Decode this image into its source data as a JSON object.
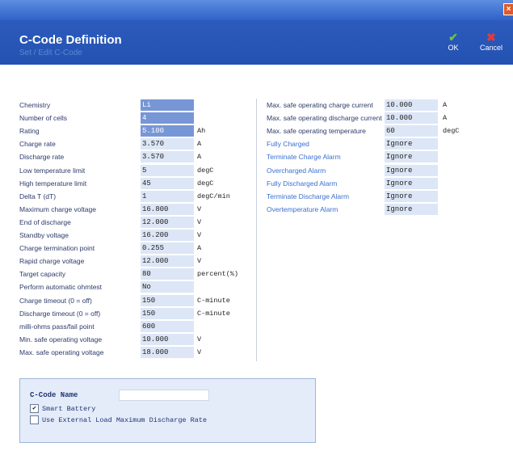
{
  "window": {
    "close_glyph": "×"
  },
  "header": {
    "title": "C-Code Definition",
    "subtitle": "Set / Edit C-Code",
    "ok_label": "OK",
    "cancel_label": "Cancel",
    "ok_icon": "✔",
    "cancel_icon": "✖"
  },
  "left_fields": [
    {
      "label": "Chemistry",
      "value": "Li",
      "unit": "",
      "selected": true
    },
    {
      "label": "Number of cells",
      "value": "4",
      "unit": "",
      "selected": true
    },
    {
      "label": "Rating",
      "value": "5.100",
      "unit": "Ah",
      "selected": true
    },
    {
      "label": "Charge rate",
      "value": "3.570",
      "unit": "A"
    },
    {
      "label": "Discharge rate",
      "value": "3.570",
      "unit": "A"
    },
    {
      "label": "Low temperature limit",
      "value": "5",
      "unit": "degC"
    },
    {
      "label": "High temperature limit",
      "value": "45",
      "unit": "degC"
    },
    {
      "label": "Delta T (dT)",
      "value": "1",
      "unit": "degC/min"
    },
    {
      "label": "Maximum charge voltage",
      "value": "16.800",
      "unit": "V"
    },
    {
      "label": "End of discharge",
      "value": "12.000",
      "unit": "V"
    },
    {
      "label": "Standby voltage",
      "value": "16.200",
      "unit": "V"
    },
    {
      "label": "Charge termination point",
      "value": "0.255",
      "unit": "A"
    },
    {
      "label": "Rapid charge voltage",
      "value": "12.000",
      "unit": "V"
    },
    {
      "label": "Target capacity",
      "value": "80",
      "unit": "percent(%)"
    },
    {
      "label": "Perform automatic ohmtest",
      "value": "No",
      "unit": ""
    },
    {
      "label": "Charge timeout (0 = off)",
      "value": "150",
      "unit": "C-minute"
    },
    {
      "label": "Discharge timeout (0 = off)",
      "value": "150",
      "unit": "C-minute"
    },
    {
      "label": "milli-ohms pass/fail point",
      "value": "600",
      "unit": ""
    },
    {
      "label": "Min. safe operating voltage",
      "value": "10.000",
      "unit": "V"
    },
    {
      "label": "Max. safe operating voltage",
      "value": "18.000",
      "unit": "V"
    }
  ],
  "right_fields": [
    {
      "label": "Max. safe operating charge current",
      "value": "10.000",
      "unit": "A",
      "link": false
    },
    {
      "label": "Max. safe operating discharge current",
      "value": "10.000",
      "unit": "A",
      "link": false
    },
    {
      "label": "Max. safe operating temperature",
      "value": "60",
      "unit": "degC",
      "link": false
    },
    {
      "label": "Fully Charged",
      "value": "Ignore",
      "unit": "",
      "link": true
    },
    {
      "label": "Terminate Charge Alarm",
      "value": "Ignore",
      "unit": "",
      "link": true
    },
    {
      "label": "Overcharged Alarm",
      "value": "Ignore",
      "unit": "",
      "link": true
    },
    {
      "label": "Fully Discharged Alarm",
      "value": "Ignore",
      "unit": "",
      "link": true
    },
    {
      "label": "Terminate Discharge Alarm",
      "value": "Ignore",
      "unit": "",
      "link": true
    },
    {
      "label": "Overtemperature Alarm",
      "value": "Ignore",
      "unit": "",
      "link": true
    }
  ],
  "ccode": {
    "title": "C-Code Name",
    "name_value": "",
    "smart_battery_label": "Smart Battery",
    "smart_battery_checked": true,
    "external_load_label": "Use External Load Maximum Discharge Rate",
    "external_load_checked": false
  },
  "colors": {
    "header_bg": "#2452b2",
    "field_bg": "#dce6f6",
    "field_selected": "#7796d6",
    "link": "#3a6fd0"
  }
}
